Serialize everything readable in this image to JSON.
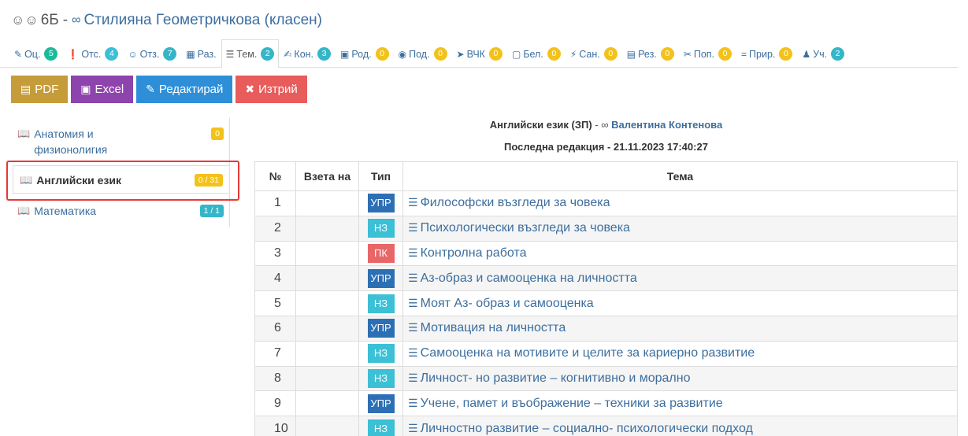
{
  "header": {
    "class_name": "6Б",
    "separator": "-",
    "teacher": "Стилияна Геометричкова (класен)"
  },
  "tabs": [
    {
      "icon": "pencil-icon",
      "glyph": "✎",
      "label": "Оц.",
      "count": "5",
      "color": "#18bc9c"
    },
    {
      "icon": "exclamation-icon",
      "glyph": "❗",
      "label": "Отс.",
      "count": "4",
      "color": "#3bc0d6"
    },
    {
      "icon": "users-icon",
      "glyph": "☺",
      "label": "Отз.",
      "count": "7",
      "color": "#35b6c8"
    },
    {
      "icon": "table-icon",
      "glyph": "▦",
      "label": "Раз.",
      "count": "",
      "color": ""
    },
    {
      "icon": "list-icon",
      "glyph": "☰",
      "label": "Тем.",
      "count": "2",
      "color": "#35b6c8"
    },
    {
      "icon": "edit-icon",
      "glyph": "✍",
      "label": "Кон.",
      "count": "3",
      "color": "#35b6c8"
    },
    {
      "icon": "calendar-icon",
      "glyph": "▣",
      "label": "Род.",
      "count": "0",
      "color": "#f3c21a"
    },
    {
      "icon": "eye-icon",
      "glyph": "◉",
      "label": "Под.",
      "count": "0",
      "color": "#f3c21a"
    },
    {
      "icon": "bullhorn-icon",
      "glyph": "➤",
      "label": "ВЧК",
      "count": "0",
      "color": "#f3c21a"
    },
    {
      "icon": "note-icon",
      "glyph": "▢",
      "label": "Бел.",
      "count": "0",
      "color": "#f3c21a"
    },
    {
      "icon": "bolt-icon",
      "glyph": "⚡",
      "label": "Сан.",
      "count": "0",
      "color": "#f3c21a"
    },
    {
      "icon": "document-icon",
      "glyph": "▤",
      "label": "Рез.",
      "count": "0",
      "color": "#f3c21a"
    },
    {
      "icon": "tools-icon",
      "glyph": "✂",
      "label": "Поп.",
      "count": "0",
      "color": "#f3c21a"
    },
    {
      "icon": "equals-icon",
      "glyph": "=",
      "label": "Прир.",
      "count": "0",
      "color": "#f3c21a"
    },
    {
      "icon": "student-icon",
      "glyph": "♟",
      "label": "Уч.",
      "count": "2",
      "color": "#35b6c8"
    }
  ],
  "active_tab": "Тем.",
  "toolbar": {
    "pdf_label": "PDF",
    "excel_label": "Excel",
    "edit_label": "Редактирай",
    "delete_label": "Изтрий"
  },
  "sidebar": {
    "items": [
      {
        "label": "Анатомия и физионолигия",
        "count": "0",
        "color": "#f3c21a",
        "active": false
      },
      {
        "label": "Английски език",
        "count": "0 / 31",
        "color": "#f3c21a",
        "active": true
      },
      {
        "label": "Математика",
        "count": "1 / 1",
        "color": "#35b6c8",
        "active": false
      }
    ]
  },
  "subject": {
    "name": "Английски език (ЗП)",
    "dash": "-",
    "teacher": "Валентина Контенова",
    "last_edit": "Последна редакция - 21.11.2023 17:40:27"
  },
  "table": {
    "headers": [
      "№",
      "Взета на",
      "Тип",
      "Тема"
    ],
    "rows": [
      {
        "num": "1",
        "taken": "",
        "type": "УПР",
        "topic": "Философски възгледи за човека"
      },
      {
        "num": "2",
        "taken": "",
        "type": "НЗ",
        "topic": "Психологически възгледи за човека"
      },
      {
        "num": "3",
        "taken": "",
        "type": "ПК",
        "topic": "Контролна работа"
      },
      {
        "num": "4",
        "taken": "",
        "type": "УПР",
        "topic": "Аз-образ и самооценка на личността"
      },
      {
        "num": "5",
        "taken": "",
        "type": "НЗ",
        "topic": "Моят Аз- образ и самооценка"
      },
      {
        "num": "6",
        "taken": "",
        "type": "УПР",
        "topic": "Мотивация на личността"
      },
      {
        "num": "7",
        "taken": "",
        "type": "НЗ",
        "topic": "Самооценка на мотивите и целите за кариерно развитие"
      },
      {
        "num": "8",
        "taken": "",
        "type": "НЗ",
        "topic": "Личност- но развитие – когнитивно и морално"
      },
      {
        "num": "9",
        "taken": "",
        "type": "УПР",
        "topic": "Учене, памет и въображение – техники за развитие"
      },
      {
        "num": "10",
        "taken": "",
        "type": "НЗ",
        "topic": "Личностно развитие – социално- психологически подход"
      }
    ]
  },
  "colors": {
    "link": "#3c6e9f",
    "upr": "#2d6fb5",
    "nz": "#3bc0d6",
    "pk": "#e86666",
    "highlight": "#e53935"
  }
}
